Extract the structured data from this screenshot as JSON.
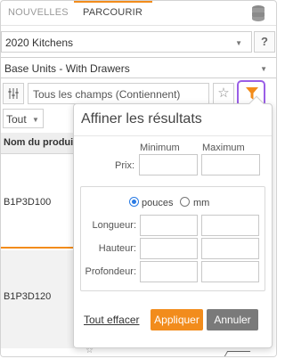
{
  "tabs": [
    {
      "label": "NOUVELLES",
      "active": false
    },
    {
      "label": "PARCOURIR",
      "active": true
    }
  ],
  "catalog_select": {
    "value": "2020 Kitchens"
  },
  "help_button": {
    "label": "?"
  },
  "category_select": {
    "value": "Base Units - With Drawers"
  },
  "search": {
    "value": "Tous les champs (Contiennent)"
  },
  "favorites": {
    "icon": "star-outline-icon"
  },
  "filter": {
    "icon": "funnel-icon",
    "color": "#f28c1c",
    "highlight": "#9a5ee6"
  },
  "list": {
    "filter_dropdown": "Tout",
    "column_header": "Nom du produit",
    "rows": [
      {
        "code": "B1P3D100"
      },
      {
        "code": "B1P3D120"
      }
    ]
  },
  "popover": {
    "title": "Affiner les résultats",
    "min_label": "Minimum",
    "max_label": "Maximum",
    "price_label": "Prix:",
    "units": [
      {
        "label": "pouces",
        "selected": true
      },
      {
        "label": "mm",
        "selected": false
      }
    ],
    "dimensions": [
      {
        "label": "Longueur:"
      },
      {
        "label": "Hauteur:"
      },
      {
        "label": "Profondeur:"
      }
    ],
    "clear_label": "Tout effacer",
    "apply_label": "Appliquer",
    "cancel_label": "Annuler"
  },
  "colors": {
    "accent": "#f28c1c",
    "selected_radio": "#2a7be4",
    "cancel": "#7a7a7a"
  }
}
